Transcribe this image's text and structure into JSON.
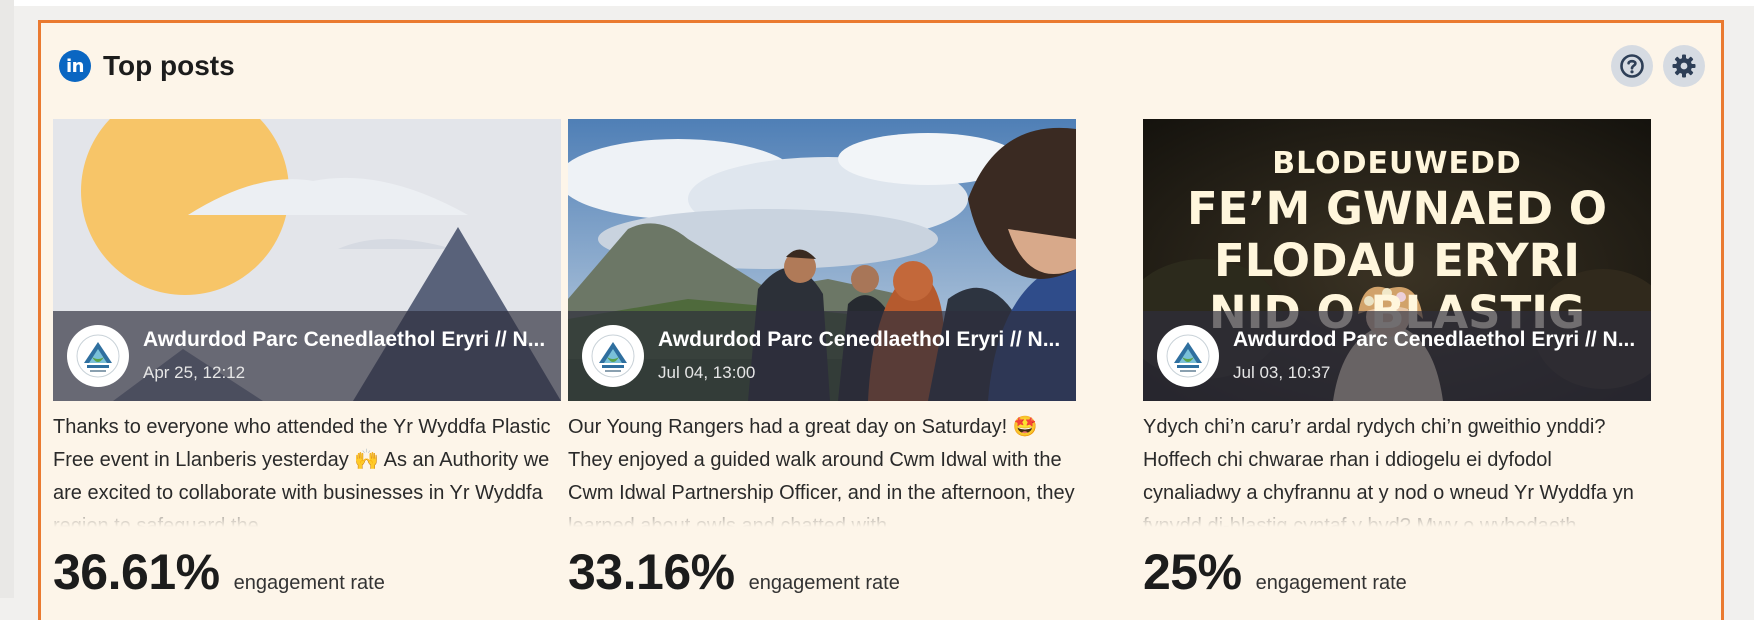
{
  "widget": {
    "title": "Top posts",
    "linkedin_icon_text": "in",
    "help_icon": "question-circle-icon",
    "settings_icon": "gear-icon"
  },
  "posts": [
    {
      "author": "Awdurdod Parc Cenedlaethol Eryri // N...",
      "date": "Apr 25, 12:12",
      "image": "placeholder-landscape",
      "text": "Thanks to everyone who attended the Yr Wyddfa Plastic Free event in Llanberis yesterday 🙌 As an Authority we are excited to collaborate with businesses in Yr Wyddfa region to safeguard the",
      "rate": "36.61%",
      "rate_label": "engagement rate"
    },
    {
      "author": "Awdurdod Parc Cenedlaethol Eryri // N...",
      "date": "Jul 04, 13:00",
      "image": "rangers-on-mountain-photo",
      "text": "Our Young Rangers had a great day on Saturday! 🤩 They enjoyed a guided walk around Cwm Idwal with the Cwm Idwal Partnership Officer, and in the afternoon, they learned about owls and chatted with",
      "rate": "33.16%",
      "rate_label": "engagement rate"
    },
    {
      "author": "Awdurdod Parc Cenedlaethol Eryri // N...",
      "date": "Jul 03, 10:37",
      "image": "blodeuwedd-poster",
      "image_text": [
        "BLODEUWEDD",
        "FE’M GWNAED O",
        "FLODAU ERYRI",
        "NID O BLASTIG"
      ],
      "text": "Ydych chi’n caru’r ardal rydych chi’n gweithio ynddi? Hoffech chi chwarae rhan i ddiogelu ei dyfodol cynaliadwy a chyfrannu at y nod o wneud Yr Wyddfa yn fynydd di-blastig cyntaf y byd? Mwy o wybodaeth",
      "rate": "25%",
      "rate_label": "engagement rate"
    }
  ],
  "colors": {
    "widget_border": "#ea7a30",
    "widget_bg": "#fdf5e9",
    "linkedin_blue": "#0a66c2",
    "icon_button_bg": "#d6dbe2",
    "icon_dark": "#2e3f57"
  }
}
